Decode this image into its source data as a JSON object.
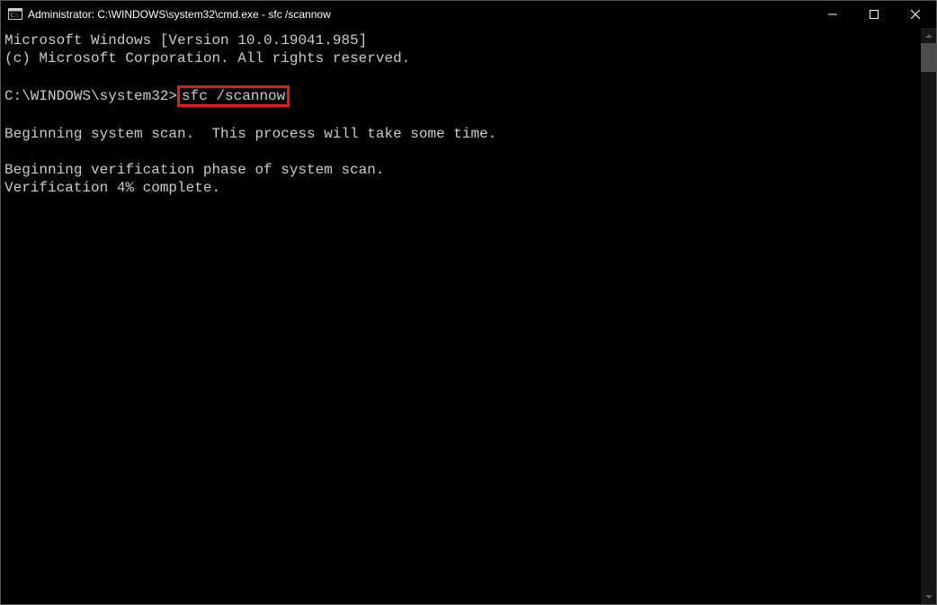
{
  "titlebar": {
    "title": "Administrator: C:\\WINDOWS\\system32\\cmd.exe - sfc  /scannow"
  },
  "terminal": {
    "line_version": "Microsoft Windows [Version 10.0.19041.985]",
    "line_copyright": "(c) Microsoft Corporation. All rights reserved.",
    "prompt": "C:\\WINDOWS\\system32>",
    "command": "sfc /scannow",
    "line_begin_scan": "Beginning system scan.  This process will take some time.",
    "line_verify_phase": "Beginning verification phase of system scan.",
    "line_verify_progress": "Verification 4% complete."
  }
}
